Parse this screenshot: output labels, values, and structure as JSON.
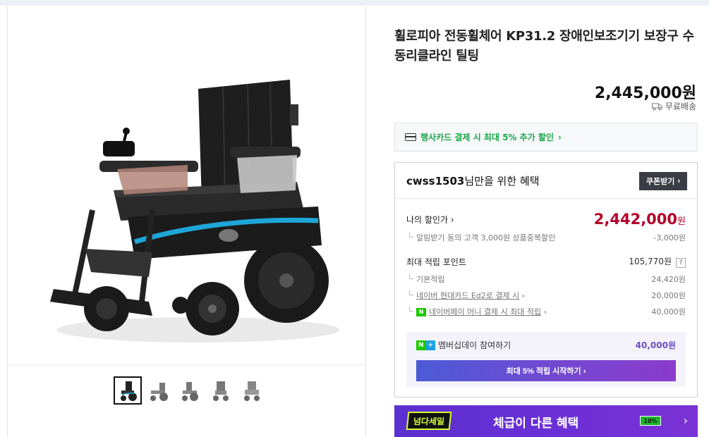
{
  "product": {
    "title": "휠로피아 전동휠체어 KP31.2 장애인보조기기 보장구 수동리클라인 틸팅",
    "price": "2,445,000원",
    "shipping": "무료배송"
  },
  "gallery": {
    "thumbnails": [
      "thumb-1",
      "thumb-2",
      "thumb-3",
      "thumb-4",
      "thumb-5"
    ],
    "selected_index": 0
  },
  "card_promo": {
    "text": "행사카드 결제 시 최대 5% 추가 할인",
    "chevron": "›"
  },
  "benefit": {
    "user": "cwss1503",
    "title_suffix": "님만을 위한 혜택",
    "coupon_button": "쿠폰받기",
    "coupon_chevron": "›",
    "my_price_label": "나의 할인가",
    "my_price_chevron": "›",
    "my_price_value": "2,442,000",
    "my_price_unit": "원",
    "alarm_label": "알림받기 동의 고객 3,000원 상품중복할인",
    "alarm_value": "-3,000원",
    "points_label": "최대 적립 포인트",
    "points_value": "105,770원",
    "points_help": "?",
    "basic_label": "기본적립",
    "basic_value": "24,420원",
    "naver_card_label": "네이버 현대카드 Ed2로 결제 시",
    "naver_card_value": "20,000원",
    "npay_label": "네이버페이 머니 결제 시 최대 적립",
    "npay_value": "40,000원",
    "npay_icon": "N",
    "link_chevron": "›",
    "membership_n": "N",
    "membership_plus": "+",
    "membership_label": "멤버십데이 참여하기",
    "membership_value": "40,000원",
    "start_button": "최대 5% 적립 시작하기 ›"
  },
  "banner": {
    "logo": "넘다세일",
    "text": "체급이 다른 혜택",
    "badge": "10%",
    "arrow": "›"
  },
  "colors": {
    "accent_price": "#b5002a",
    "card_promo_green": "#1aa849",
    "membership_purple": "#6c4fbf",
    "banner_purple": "#6a2fd6"
  }
}
